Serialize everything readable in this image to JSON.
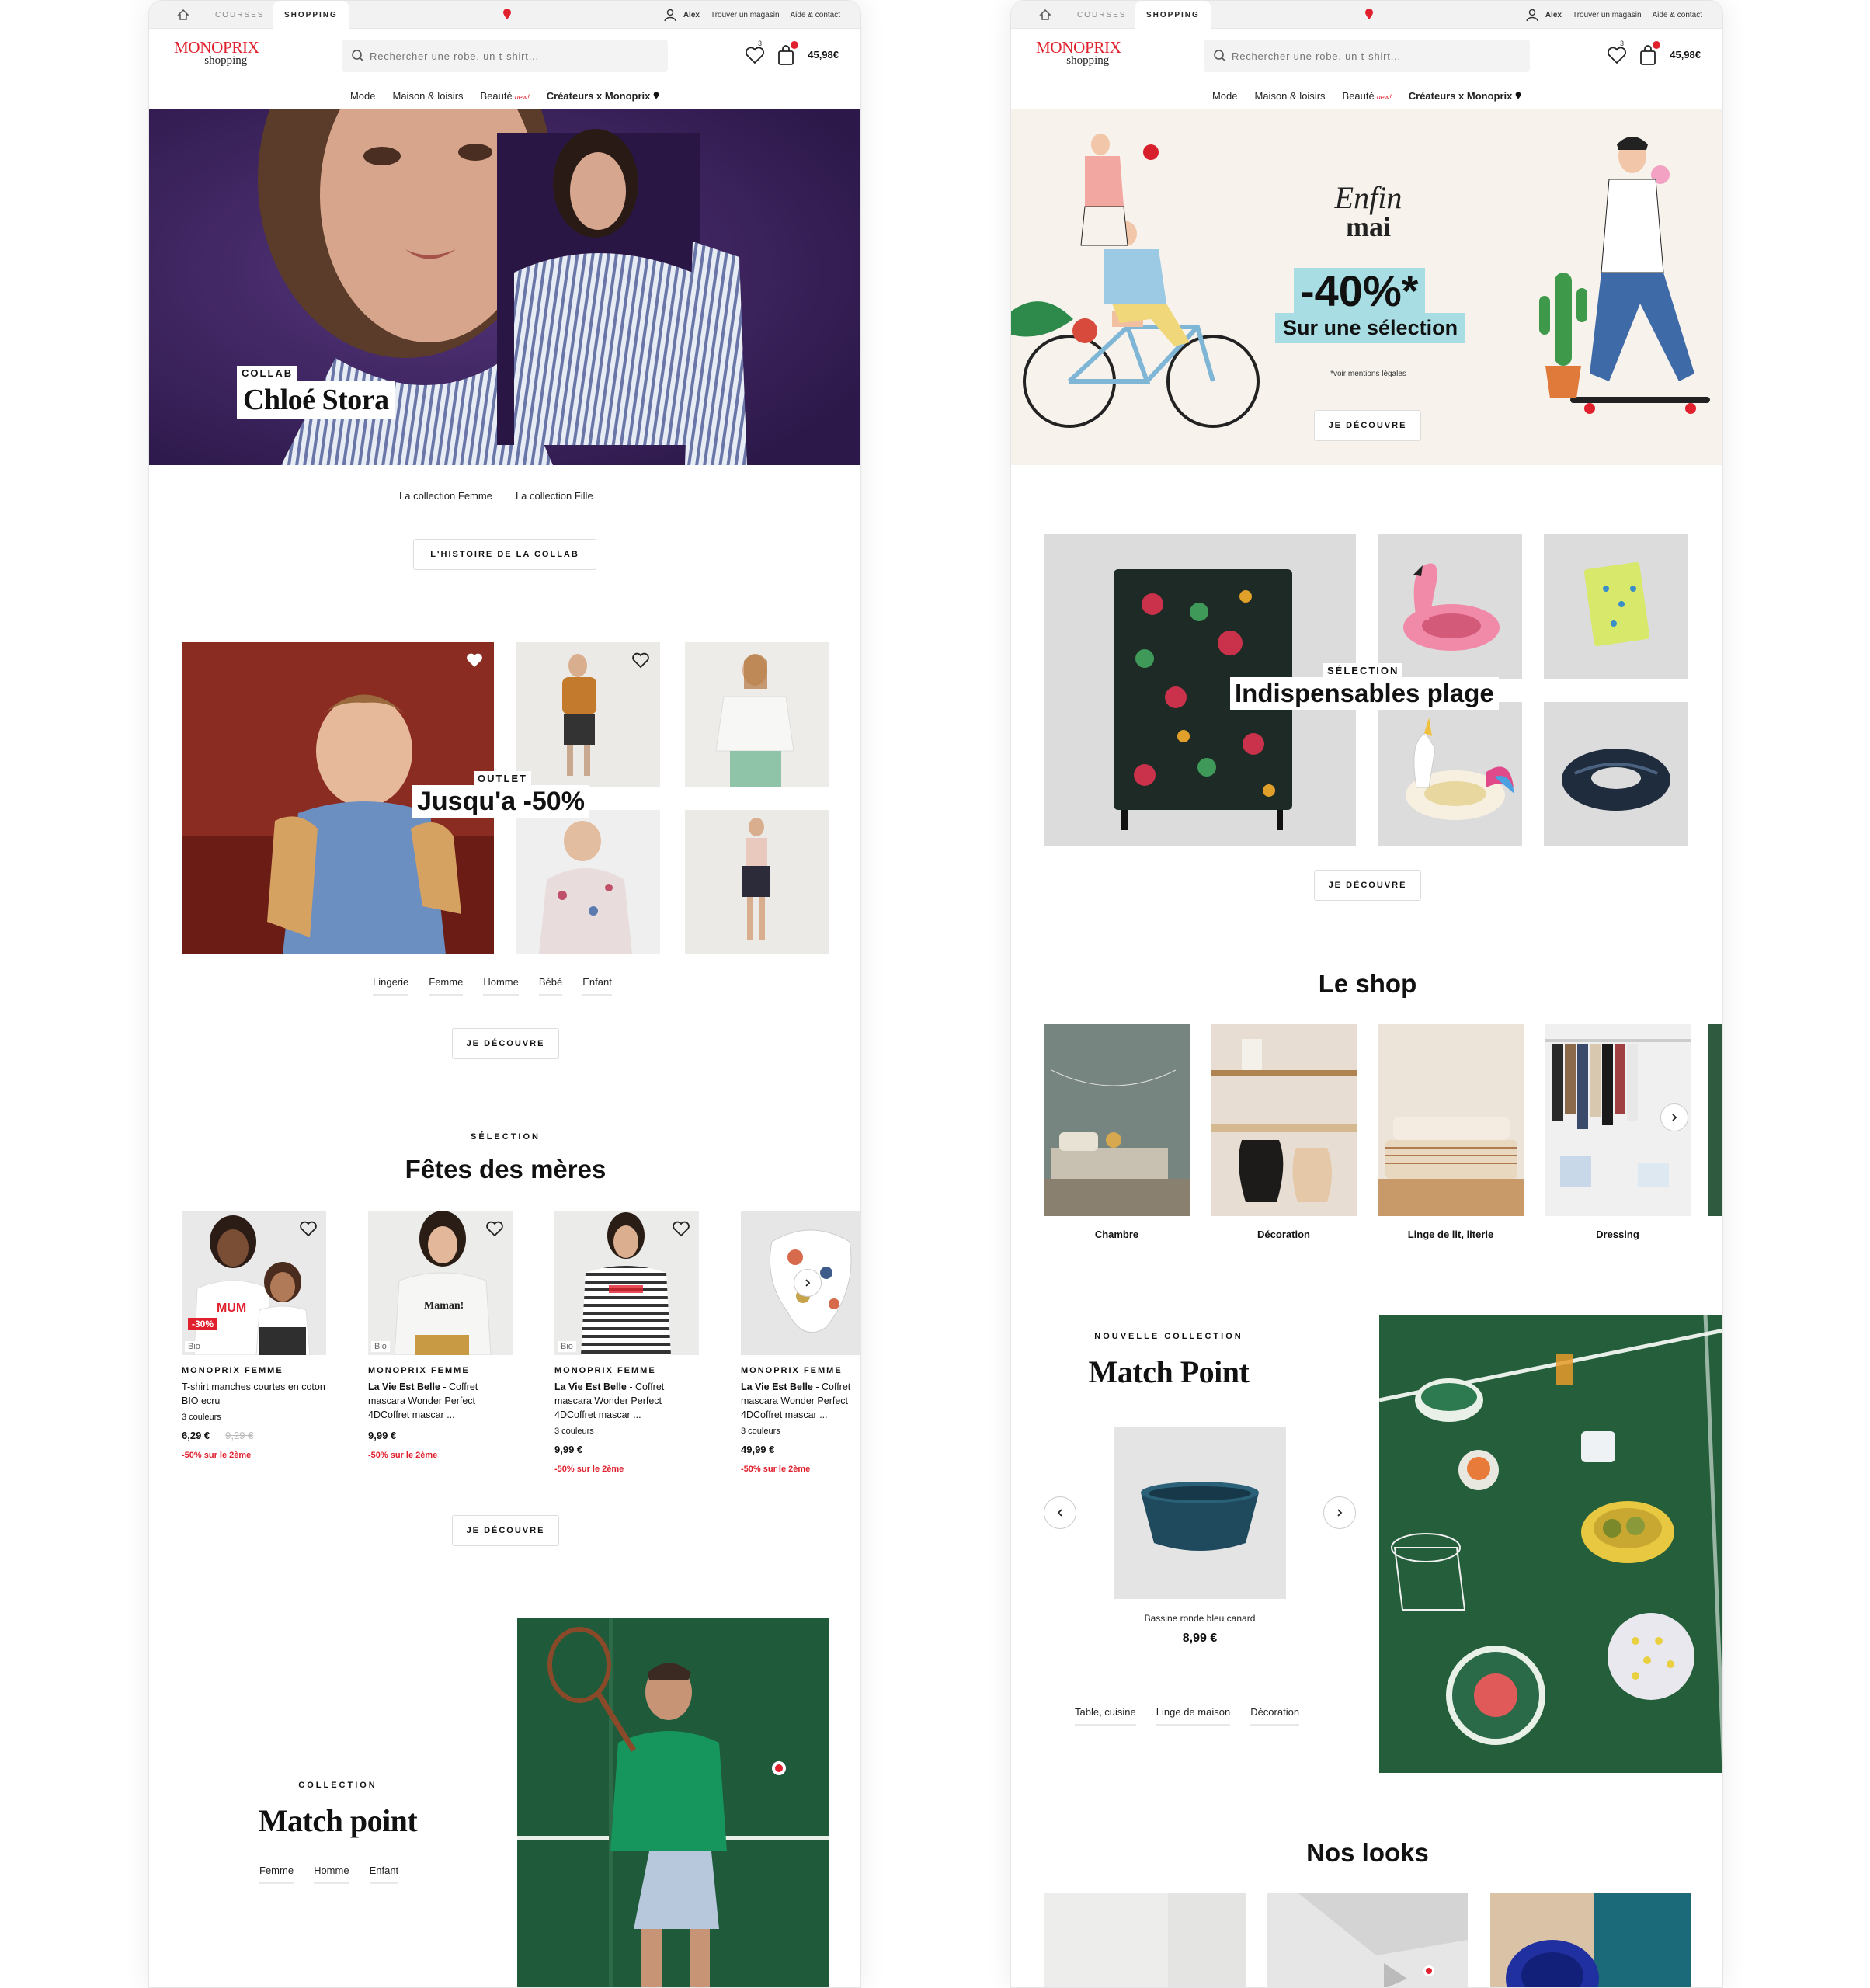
{
  "colors": {
    "brand": "#e0202d",
    "hero_purple": "#3e2461",
    "tennis_green": "#1f5a3b",
    "hero_cream": "#f7f3ec",
    "promo_teal": "#a8dde3"
  },
  "topbar": {
    "courses": "COURSES",
    "shopping": "SHOPPING",
    "user": "Alex",
    "store": "Trouver un magasin",
    "help": "Aide & contact"
  },
  "header": {
    "logo_brand": "MONOPRIX",
    "logo_sub": "shopping",
    "search_placeholder": "Rechercher une robe, un t-shirt...",
    "fav_count": "3",
    "cart_total": "45,98€"
  },
  "nav": {
    "mode": "Mode",
    "maison": "Maison & loisirs",
    "beaute": "Beauté",
    "beaute_new": "new!",
    "createurs": "Créateurs x Monoprix"
  },
  "left": {
    "hero": {
      "tag": "COLLAB",
      "title": "Chloé Stora"
    },
    "collab_links": [
      "La collection Femme",
      "La collection Fille"
    ],
    "collab_button": "L'HISTOIRE DE LA COLLAB",
    "outlet": {
      "tag": "OUTLET",
      "title": "Jusqu'a -50%"
    },
    "category_links": [
      "Lingerie",
      "Femme",
      "Homme",
      "Bébé",
      "Enfant"
    ],
    "discover": "JE DÉCOUVRE",
    "fetes": {
      "eyebrow": "SÉLECTION",
      "title": "Fêtes des mères"
    },
    "products": [
      {
        "brand": "MONOPRIX FEMME",
        "name": "T-shirt manches courtes en coton BIO ecru",
        "colors": "3 couleurs",
        "price": "6,29 €",
        "old": "9,29 €",
        "promo": "-50% sur le 2ème",
        "bio": "Bio",
        "discount": "-30%",
        "shirt": "MUM"
      },
      {
        "brand": "MONOPRIX FEMME",
        "name": "La Vie Est Belle - Coffret mascara Wonder Perfect 4DCoffret mascar ...",
        "colors": "",
        "price": "9,99 €",
        "old": "",
        "promo": "-50% sur le 2ème",
        "bio": "Bio",
        "shirt": "Maman!"
      },
      {
        "brand": "MONOPRIX FEMME",
        "name": "La Vie Est Belle - Coffret mascara Wonder Perfect 4DCoffret mascar ...",
        "colors": "3 couleurs",
        "price": "9,99 €",
        "old": "",
        "promo": "-50% sur le 2ème",
        "bio": "Bio"
      },
      {
        "brand": "MONOPRIX FEMME",
        "name": "La Vie Est Belle - Coffret mascara Wonder Perfect 4DCoffret mascar ...",
        "colors": "3 couleurs",
        "price": "49,99 €",
        "old": "",
        "promo": "-50% sur le 2ème"
      }
    ],
    "products_button": "JE DÉCOUVRE",
    "matchpoint": {
      "eyebrow": "COLLECTION",
      "title": "Match point",
      "links": [
        "Femme",
        "Homme",
        "Enfant"
      ]
    }
  },
  "right": {
    "hero": {
      "line1": "Enfin",
      "line2": "mai",
      "discount": "-40%*",
      "sub": "Sur une sélection",
      "legal": "*voir mentions légales",
      "button": "JE DÉCOUVRE"
    },
    "plage": {
      "tag": "SÉLECTION",
      "title": "Indispensables plage",
      "button": "JE DÉCOUVRE"
    },
    "shop": {
      "title": "Le shop",
      "items": [
        "Chambre",
        "Décoration",
        "Linge de lit, literie",
        "Dressing"
      ]
    },
    "match": {
      "eyebrow": "NOUVELLE COLLECTION",
      "title": "Match Point",
      "product_name": "Bassine ronde bleu canard",
      "product_price": "8,99 €",
      "links": [
        "Table, cuisine",
        "Linge de maison",
        "Décoration"
      ]
    },
    "looks": {
      "title": "Nos looks"
    }
  }
}
